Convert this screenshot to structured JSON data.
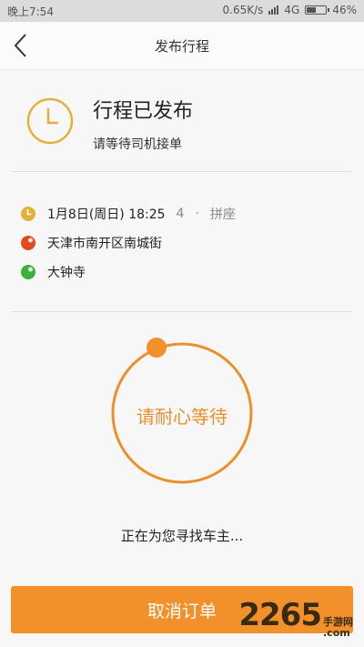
{
  "status_bar": {
    "time": "晚上7:54",
    "speed": "0.65K/s",
    "network": "4G",
    "battery": "46%",
    "battery_level": 0.46
  },
  "nav": {
    "title": "发布行程",
    "back_icon": "chevron-left-icon"
  },
  "header": {
    "title": "行程已发布",
    "subtitle": "请等待司机接单",
    "icon": "clock-icon"
  },
  "trip": {
    "time": "1月8日(周日) 18:25",
    "seats": "4",
    "separator": "·",
    "type": "拼座",
    "origin": "天津市南开区南城街",
    "destination": "大钟寺"
  },
  "waiting": {
    "ring_label": "请耐心等待",
    "status": "正在为您寻找车主..."
  },
  "actions": {
    "cancel_label": "取消订单"
  },
  "watermark": {
    "number": "2265",
    "suffix_top": "手游网",
    "suffix_bottom": ".com"
  },
  "colors": {
    "accent": "#f2902a",
    "clock": "#e3b13a",
    "origin_dot": "#e24a1c",
    "destination_dot": "#3fae3a"
  }
}
